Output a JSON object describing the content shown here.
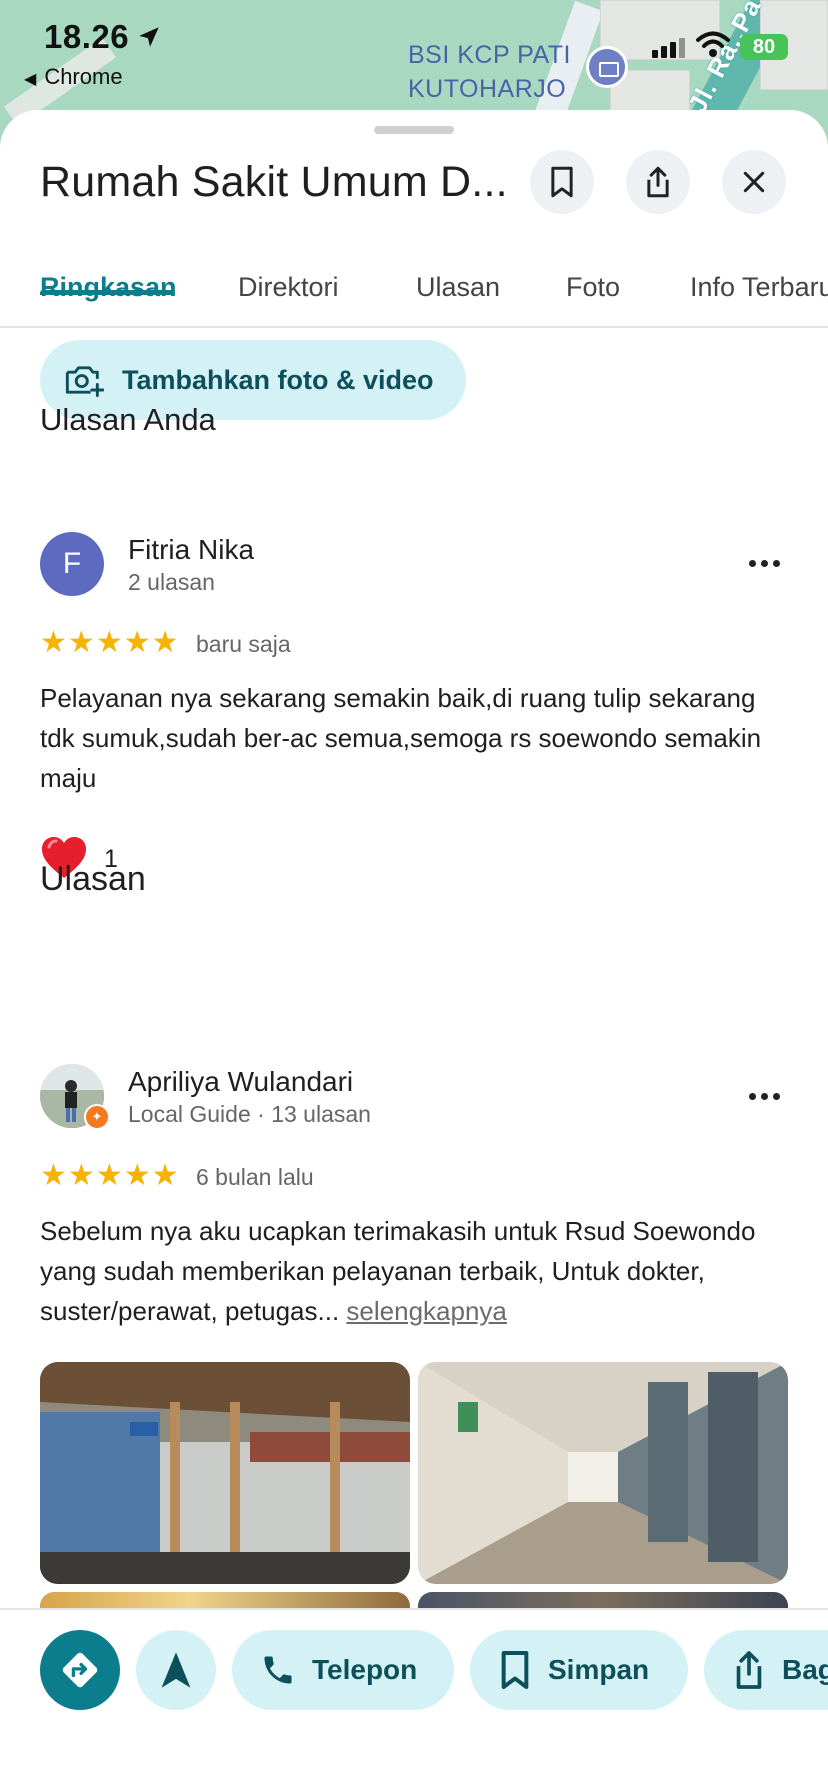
{
  "status_bar": {
    "time": "18.26",
    "back_app": "Chrome",
    "battery": "80"
  },
  "map": {
    "poi_label_line1": "BSI KCP PATI",
    "poi_label_line2": "KUTOHARJO",
    "street_label": "Jl. Ra..Pa"
  },
  "place": {
    "title": "Rumah Sakit Umum D..."
  },
  "tabs": [
    "Ringkasan",
    "Direktori",
    "Ulasan",
    "Foto",
    "Info Terbaru"
  ],
  "add_media": {
    "label": "Tambahkan foto & video"
  },
  "your_review": {
    "heading": "Ulasan Anda",
    "author": "Fitria Nika",
    "initial": "F",
    "meta": "2 ulasan",
    "rating": 5,
    "time": "baru saja",
    "text": "Pelayanan nya sekarang semakin baik,di ruang tulip sekarang tdk sumuk,sudah ber-ac semua,semoga rs soewondo semakin maju",
    "likes": "1"
  },
  "reviews": {
    "heading": "Ulasan",
    "items": [
      {
        "author": "Apriliya Wulandari",
        "meta": "Local Guide · 13 ulasan",
        "rating": 5,
        "time": "6 bulan lalu",
        "text": "Sebelum nya aku ucapkan terimakasih untuk Rsud Soewondo yang sudah memberikan pelayanan terbaik, Untuk dokter, suster/perawat, petugas...",
        "more_link": "selengkapnya"
      }
    ]
  },
  "actions": {
    "call": "Telepon",
    "save": "Simpan",
    "share": "Bagikan"
  },
  "colors": {
    "accent": "#0b7d8c",
    "pill_bg": "#d4f2f6",
    "star": "#f6b400",
    "avatar": "#5c6bc0"
  }
}
